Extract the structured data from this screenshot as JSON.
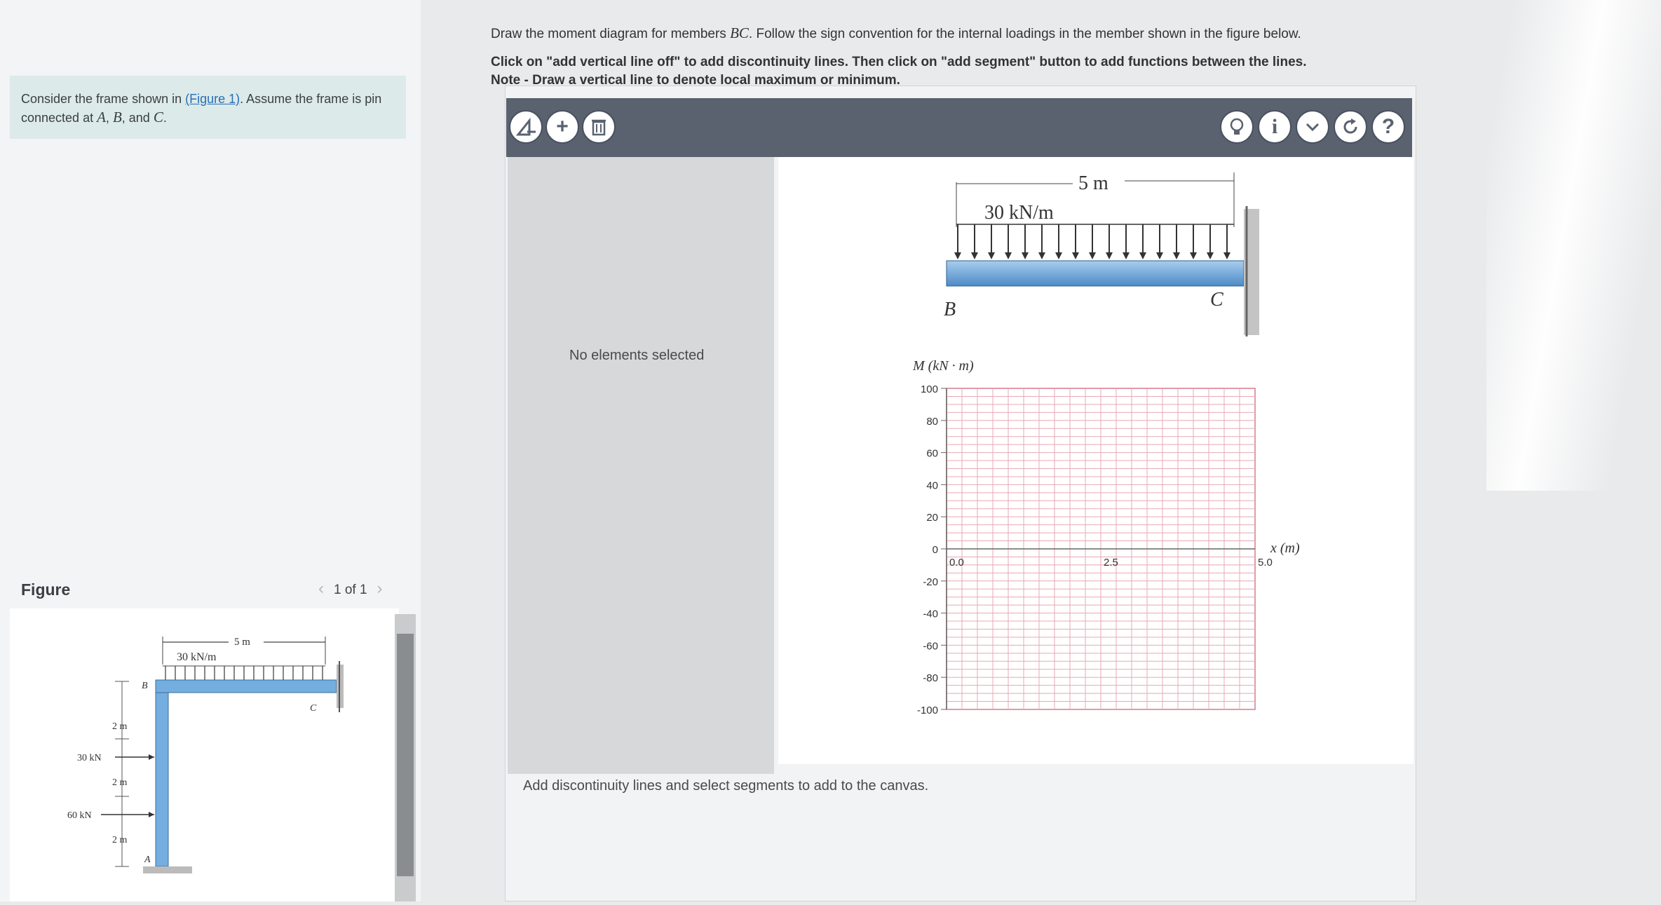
{
  "problem": {
    "text_before": "Consider the frame shown in ",
    "figure_link": "(Figure 1)",
    "text_after": ". Assume the frame is pin connected at ",
    "points": [
      "A",
      "B",
      "C"
    ],
    "sep1": ", ",
    "sep2": ", and ",
    "end": "."
  },
  "figure_panel": {
    "label": "Figure",
    "pager": "1 of 1",
    "dim_top": "5 m",
    "load": "30 kN/m",
    "point_b": "B",
    "point_c": "C",
    "point_a": "A",
    "seg1": "2 m",
    "seg2": "2 m",
    "seg3": "2 m",
    "force1": "30 kN",
    "force2": "60 kN"
  },
  "instructions": {
    "line1_pre": "Draw the moment diagram for members ",
    "line1_member": "BC",
    "line1_post": ". Follow the sign convention for the internal loadings in the member shown in the figure below.",
    "line2": "Click on \"add vertical line off\" to add discontinuity lines. Then click on \"add segment\" button to add functions between the lines.",
    "line3": "Note - Draw a vertical line to denote local maximum or minimum."
  },
  "toolbar": {
    "left_buttons": [
      "add-vertical-line",
      "add-segment",
      "delete"
    ],
    "right_buttons": [
      "hint",
      "info",
      "dropdown",
      "reset",
      "help"
    ]
  },
  "side_panel": {
    "status": "No elements selected"
  },
  "beam": {
    "span": "5 m",
    "load": "30 kN/m",
    "left_label": "B",
    "right_label": "C"
  },
  "chart_data": {
    "type": "line",
    "ylabel": "M (kN · m)",
    "xlabel": "x (m)",
    "ylim": [
      -100,
      100
    ],
    "xlim": [
      0,
      5
    ],
    "yticks": [
      100,
      80,
      60,
      40,
      20,
      0,
      -20,
      -40,
      -60,
      -80,
      -100
    ],
    "xticks": [
      "0.0",
      "2.5",
      "5.0"
    ],
    "grid": true,
    "series": []
  },
  "footer": {
    "note": "Add discontinuity lines and select segments to add to the canvas."
  }
}
